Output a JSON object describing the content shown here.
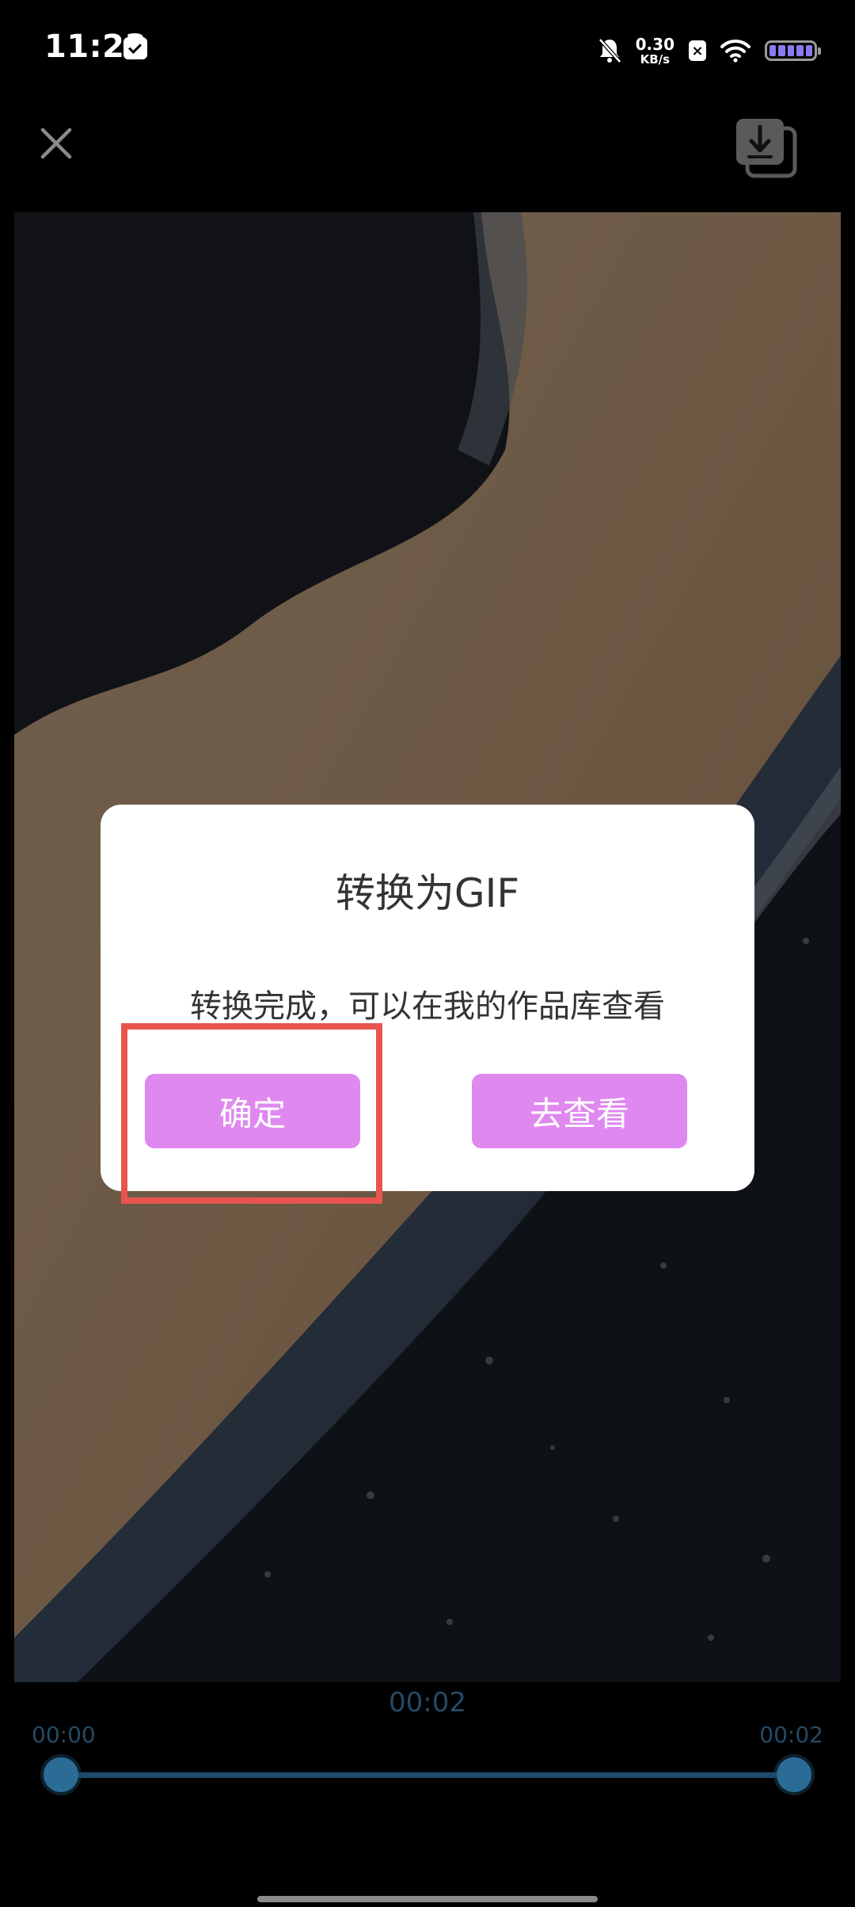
{
  "status_bar": {
    "time": "11:23",
    "net_speed_value": "0.30",
    "net_speed_unit": "KB/s",
    "icons": [
      "message-icon",
      "bell-muted-icon",
      "sim-x-icon",
      "wifi-icon",
      "battery-icon"
    ]
  },
  "top_bar": {
    "close_icon": "close-icon",
    "download_icon": "download-icon"
  },
  "dialog": {
    "title": "转换为GIF",
    "message": "转换完成，可以在我的作品库查看",
    "confirm_label": "确定",
    "view_label": "去查看"
  },
  "timeline": {
    "current_time": "00:02",
    "start_time": "00:00",
    "end_time": "00:02"
  },
  "colors": {
    "button_bg": "#df88ef",
    "highlight": "#e8554e",
    "timeline": "#244a66"
  }
}
